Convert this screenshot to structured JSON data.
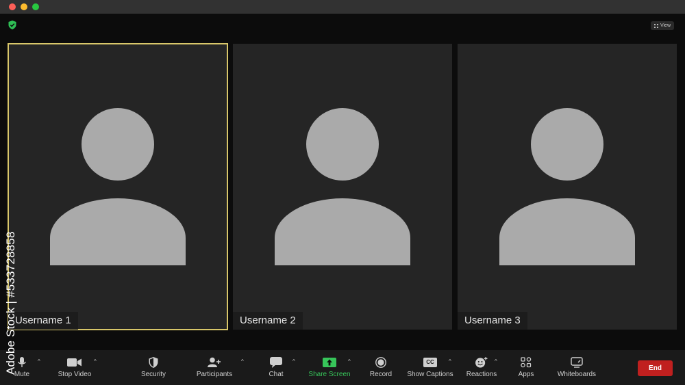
{
  "window": {
    "traffic_lights": [
      {
        "name": "close",
        "color": "#fe5f57"
      },
      {
        "name": "minimize",
        "color": "#febc2e"
      },
      {
        "name": "zoom",
        "color": "#28c840"
      }
    ]
  },
  "header": {
    "security_icon": "green-shield-check-icon",
    "view_label": "View"
  },
  "participants": [
    {
      "name": "Username 1",
      "active_speaker": true
    },
    {
      "name": "Username 2",
      "active_speaker": false
    },
    {
      "name": "Username 3",
      "active_speaker": false
    }
  ],
  "toolbar": {
    "mute": "Mute",
    "stop_video": "Stop Video",
    "security": "Security",
    "participants": "Participants",
    "chat": "Chat",
    "share_screen": "Share Screen",
    "record": "Record",
    "show_captions": "Show Captions",
    "cc": "CC",
    "reactions": "Reactions",
    "apps": "Apps",
    "whiteboards": "Whiteboards",
    "end": "End",
    "caret": "^"
  },
  "colors": {
    "active_border": "#d9c76a",
    "share_green": "#37c55a",
    "end_red": "#c0201f"
  },
  "watermark": {
    "text": "Adobe Stock | #533728858"
  }
}
